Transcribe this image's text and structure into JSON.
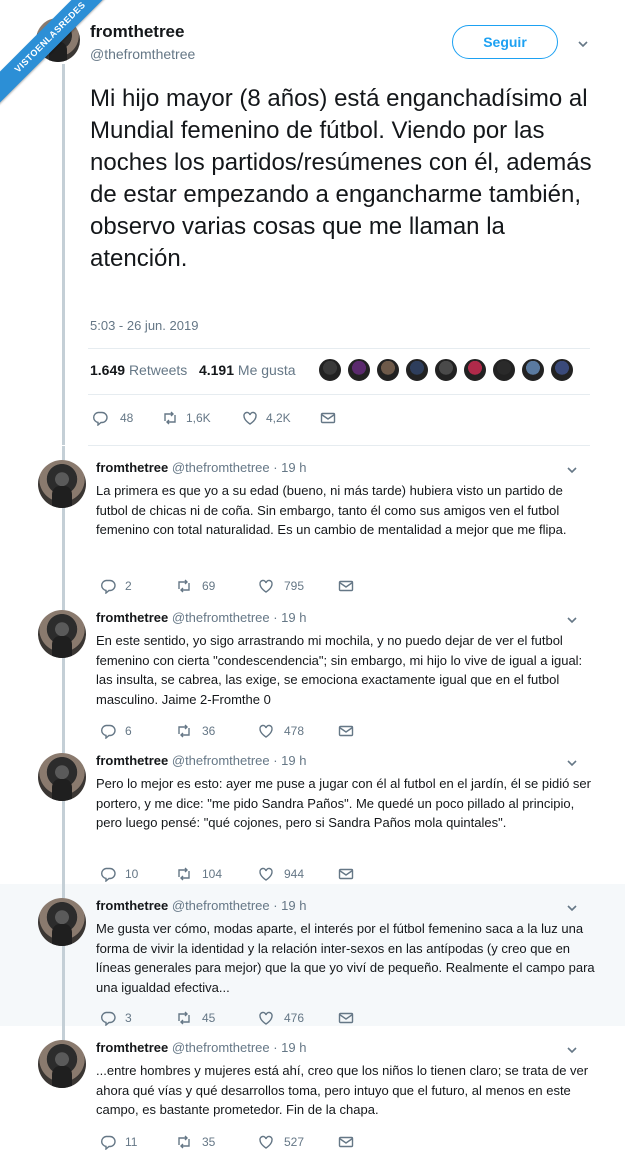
{
  "watermark": "VISTOENLASREDES",
  "main": {
    "name": "fromthetree",
    "handle": "@thefromthetree",
    "follow_label": "Seguir",
    "text": "Mi hijo mayor (8 años) está enganchadísimo al Mundial femenino de fútbol. Viendo por las noches los partidos/resúmenes con él, además de estar empezando a engancharme también, observo varias cosas que me llaman la atención.",
    "timestamp": "5:03 - 26 jun. 2019",
    "retweets_count": "1.649",
    "retweets_label": "Retweets",
    "likes_count": "4.191",
    "likes_label": "Me gusta",
    "replies": "48",
    "rts": "1,6K",
    "likes": "4,2K"
  },
  "replies": [
    {
      "name": "fromthetree",
      "handle": "@thefromthetree",
      "time": "· 19 h",
      "text": "La primera es que yo a su edad (bueno, ni más tarde) hubiera visto un partido de futbol de chicas ni de coña. Sin embargo, tanto él como sus amigos ven el futbol femenino con total naturalidad. Es un cambio de mentalidad a mejor que me flipa.",
      "replies": "2",
      "rts": "69",
      "likes": "795"
    },
    {
      "name": "fromthetree",
      "handle": "@thefromthetree",
      "time": "· 19 h",
      "text": "En este sentido, yo sigo arrastrando mi mochila, y no puedo dejar de ver el futbol femenino con cierta \"condescendencia\"; sin embargo, mi hijo lo vive de igual a igual: las insulta, se cabrea, las exige, se emociona exactamente igual que en el futbol masculino. Jaime 2-Fromthe 0",
      "replies": "6",
      "rts": "36",
      "likes": "478"
    },
    {
      "name": "fromthetree",
      "handle": "@thefromthetree",
      "time": "· 19 h",
      "text": "Pero lo mejor es esto: ayer me puse a jugar con él al futbol en el jardín, él se pidió ser portero, y me dice: \"me pido Sandra Paños\". Me quedé un poco pillado al principio, pero luego pensé: \"qué cojones, pero si Sandra Paños mola quintales\".",
      "replies": "10",
      "rts": "104",
      "likes": "944"
    },
    {
      "name": "fromthetree",
      "handle": "@thefromthetree",
      "time": "· 19 h",
      "text": "Me gusta ver cómo, modas aparte, el interés por el fútbol femenino saca a la luz una forma de vivir la identidad y la relación inter-sexos en las antípodas (y creo que en líneas generales para mejor) que la que yo viví de pequeño. Realmente el campo para una igualdad efectiva...",
      "replies": "3",
      "rts": "45",
      "likes": "476"
    },
    {
      "name": "fromthetree",
      "handle": "@thefromthetree",
      "time": "· 19 h",
      "text": "...entre hombres y mujeres está ahí, creo que los niños lo tienen claro; se trata de ver ahora qué vías y qué desarrollos toma, pero intuyo que el futuro, al menos en este campo, es bastante prometedor. Fin de la chapa.",
      "replies": "11",
      "rts": "35",
      "likes": "527"
    }
  ],
  "colors": {
    "accent": "#1da1f2",
    "muted": "#657786",
    "line": "#c4cfd6",
    "highlight": "#f5f8fa"
  },
  "liker_colors": [
    "#3a3a3a",
    "#5b2a6e",
    "#6e5a4a",
    "#2e3e5c",
    "#4a4a4a",
    "#b02a4a",
    "#2a2a2a",
    "#5a7aa0",
    "#3a4a7a"
  ]
}
